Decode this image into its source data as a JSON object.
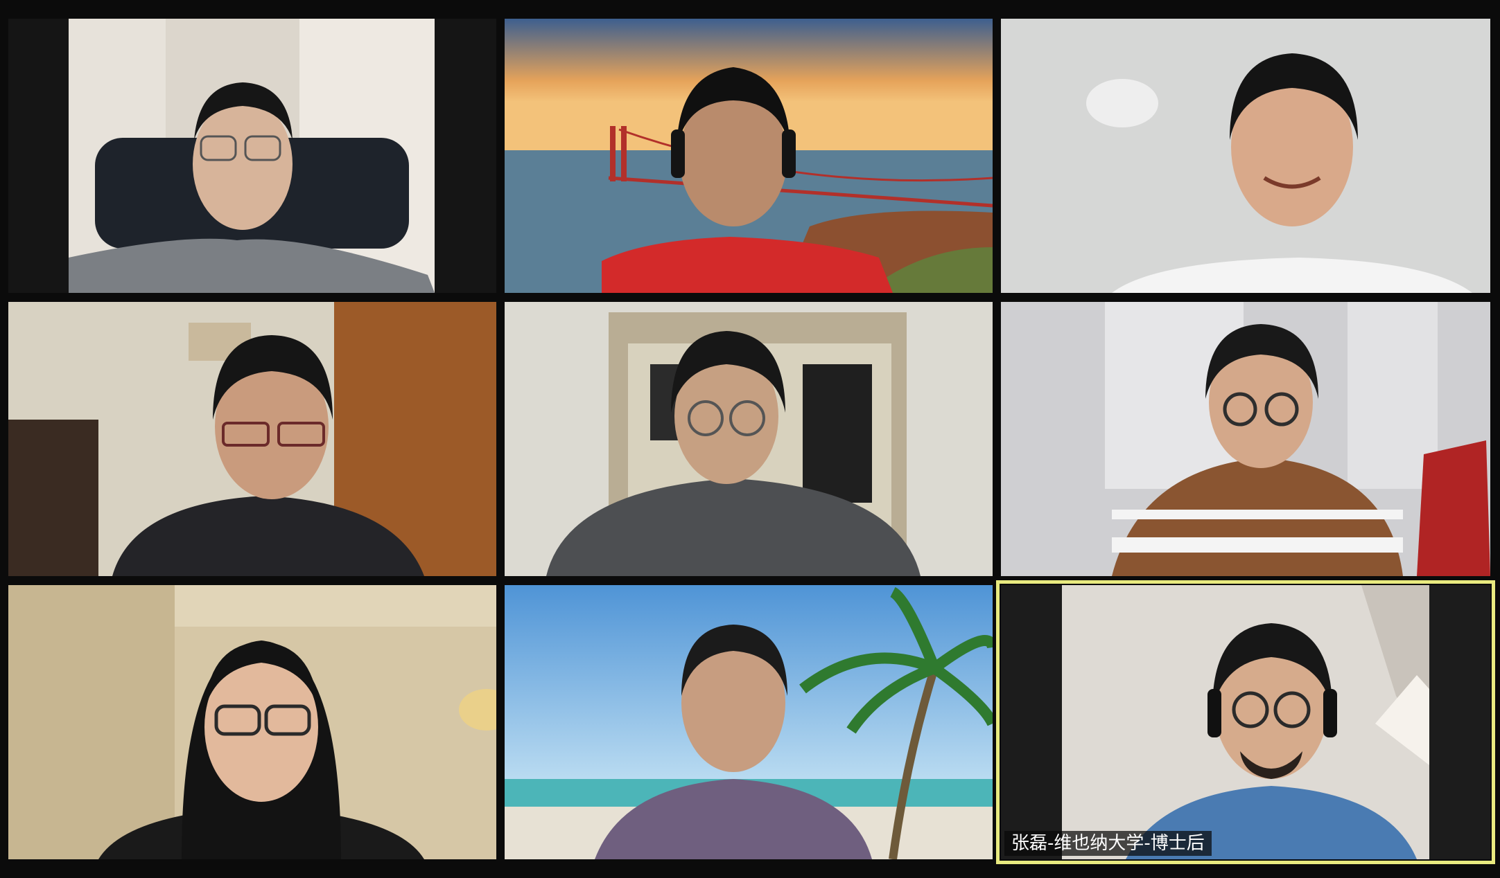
{
  "meeting": {
    "view": "gallery",
    "columns": 3,
    "rows": 3
  },
  "participants": [
    {
      "id": 1,
      "name": "",
      "backdrop": "home-curtain",
      "shirt_color": "#7b7f84"
    },
    {
      "id": 2,
      "name": "",
      "backdrop": "golden-gate-sunset",
      "shirt_color": "#d32a2a"
    },
    {
      "id": 3,
      "name": "",
      "backdrop": "white-wall",
      "shirt_color": "#f4f4f4"
    },
    {
      "id": 4,
      "name": "",
      "backdrop": "living-room-shelf",
      "shirt_color": "#242428"
    },
    {
      "id": 5,
      "name": "",
      "backdrop": "room-with-door",
      "shirt_color": "#4d4f52"
    },
    {
      "id": 6,
      "name": "",
      "backdrop": "office-whiteboard",
      "shirt_color": "#8a5531"
    },
    {
      "id": 7,
      "name": "",
      "backdrop": "room-lamp",
      "shirt_color": "#1a1a1a"
    },
    {
      "id": 8,
      "name": "",
      "backdrop": "tropical-beach",
      "shirt_color": "#6f5f7f"
    },
    {
      "id": 9,
      "name": "张磊-维也纳大学-博士后",
      "backdrop": "attic-room",
      "shirt_color": "#4a7bb2",
      "active_speaker": true
    }
  ],
  "colors": {
    "active_speaker_border": "#e8ea7f",
    "background": "#0b0b0b"
  }
}
